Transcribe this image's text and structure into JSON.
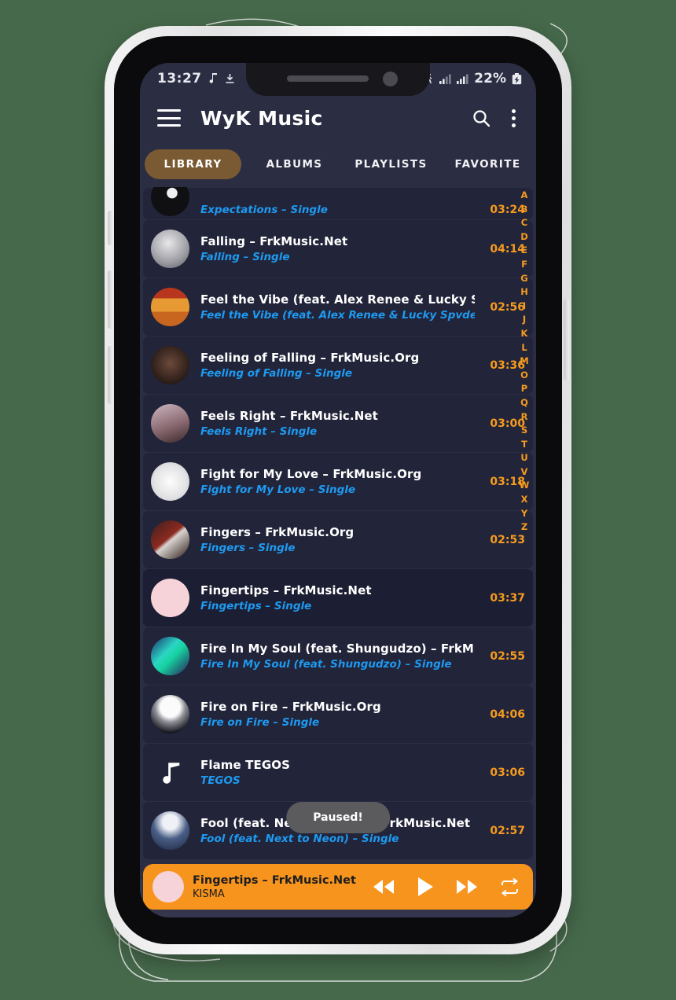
{
  "status_bar": {
    "time": "13:27",
    "battery_pct": "22%",
    "icons": [
      "music-note-icon",
      "download-icon",
      "cast-icon",
      "signal-bars-icon",
      "signal-bars-icon",
      "battery-charging-icon"
    ]
  },
  "app_bar": {
    "title": "WyK Music",
    "menu_icon": "hamburger-icon",
    "search_icon": "search-icon",
    "overflow_icon": "kebab-menu-icon"
  },
  "tabs": [
    {
      "label": "LIBRARY",
      "active": true
    },
    {
      "label": "ALBUMS",
      "active": false
    },
    {
      "label": "PLAYLISTS",
      "active": false
    },
    {
      "label": "FAVORITE",
      "active": false
    }
  ],
  "az_index": [
    "A",
    "B",
    "C",
    "D",
    "E",
    "F",
    "G",
    "H",
    "I",
    "J",
    "K",
    "L",
    "M",
    "O",
    "P",
    "Q",
    "R",
    "S",
    "T",
    "U",
    "V",
    "W",
    "X",
    "Y",
    "Z"
  ],
  "songs": [
    {
      "title": "",
      "subtitle": "Expectations – Single",
      "duration": "03:24",
      "clipped": true,
      "art": "dark-vinyl",
      "playing": false
    },
    {
      "title": "Falling – FrkMusic.Net",
      "subtitle": "Falling – Single",
      "duration": "04:14",
      "clipped": false,
      "art": "grey-moon",
      "playing": false
    },
    {
      "title": "Feel the Vibe (feat. Alex Renee & Lucky Spv...",
      "subtitle": "Feel the Vibe (feat. Alex Renee & Lucky Spvde) – Si...",
      "duration": "02:56",
      "clipped": false,
      "art": "orange-car",
      "playing": false
    },
    {
      "title": "Feeling of Falling – FrkMusic.Org",
      "subtitle": "Feeling of Falling – Single",
      "duration": "03:36",
      "clipped": false,
      "art": "dark-space",
      "playing": false
    },
    {
      "title": "Feels Right – FrkMusic.Net",
      "subtitle": "Feels Right – Single",
      "duration": "03:00",
      "clipped": false,
      "art": "mauve-portrait",
      "playing": false
    },
    {
      "title": "Fight for My Love – FrkMusic.Org",
      "subtitle": "Fight for My Love – Single",
      "duration": "03:18",
      "clipped": false,
      "art": "white-snow",
      "playing": false
    },
    {
      "title": "Fingers – FrkMusic.Org",
      "subtitle": "Fingers – Single",
      "duration": "02:53",
      "clipped": false,
      "art": "red-hand",
      "playing": false
    },
    {
      "title": "Fingertips – FrkMusic.Net",
      "subtitle": "Fingertips – Single",
      "duration": "03:37",
      "clipped": false,
      "art": "pink-hands",
      "playing": true
    },
    {
      "title": "Fire In My Soul (feat. Shungudzo) – FrkMu...",
      "subtitle": "Fire In My Soul (feat. Shungudzo) – Single",
      "duration": "02:55",
      "clipped": false,
      "art": "neon-fire",
      "playing": false
    },
    {
      "title": "Fire on Fire – FrkMusic.Org",
      "subtitle": "Fire on Fire – Single",
      "duration": "04:06",
      "clipped": false,
      "art": "moon-night",
      "playing": false
    },
    {
      "title": "Flame TEGOS",
      "subtitle": "TEGOS",
      "duration": "03:06",
      "clipped": false,
      "art": "note-placeholder",
      "playing": false
    },
    {
      "title": "Fool (feat. Next to Neon) – FrkMusic.Net",
      "subtitle": "Fool (feat. Next to Neon) – Single",
      "duration": "02:57",
      "clipped": false,
      "art": "blue-fool",
      "playing": false
    }
  ],
  "toast": {
    "message": "Paused!"
  },
  "player": {
    "title": "Fingertips – FrkMusic.Net",
    "artist": "KISMA",
    "art": "pink-hands",
    "prev_icon": "rewind-icon",
    "play_icon": "play-icon",
    "next_icon": "fast-forward-icon",
    "repeat_icon": "repeat-icon"
  },
  "nav_bar": {
    "recents_icon": "recents-icon",
    "home_icon": "home-icon",
    "back_icon": "back-icon"
  },
  "colors": {
    "background": "#46694b",
    "screen_bg": "#2b2d42",
    "accent_orange": "#f7941d",
    "tab_active": "#7a5a32",
    "subtitle_blue": "#1e9af0",
    "duration_orange": "#f59b1e"
  }
}
